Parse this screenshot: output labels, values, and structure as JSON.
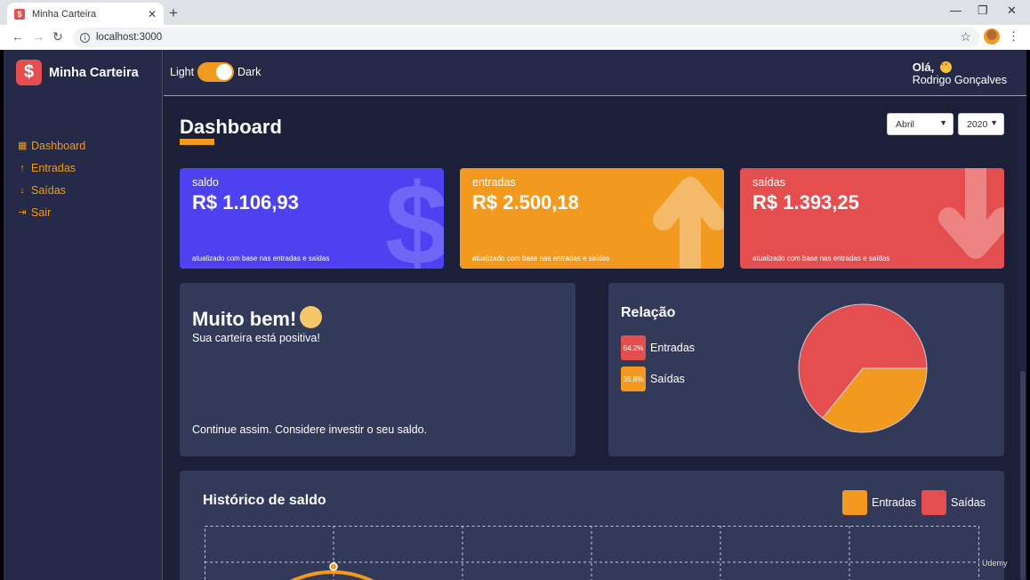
{
  "browser": {
    "tab_title": "Minha Carteira",
    "url": "localhost:3000",
    "new_tab": "+",
    "close_tab": "✕"
  },
  "sidebar": {
    "logo": "$",
    "title": "Minha Carteira",
    "items": [
      {
        "label": "Dashboard",
        "icon": "dashboard-icon",
        "glyph": "▦"
      },
      {
        "label": "Entradas",
        "icon": "arrow-up-icon",
        "glyph": "↑"
      },
      {
        "label": "Saídas",
        "icon": "arrow-down-icon",
        "glyph": "↓"
      },
      {
        "label": "Sair",
        "icon": "exit-icon",
        "glyph": "⇥"
      }
    ]
  },
  "header": {
    "theme_light": "Light",
    "theme_dark": "Dark",
    "greeting": "Olá,",
    "user_name": "Rodrigo Gonçalves"
  },
  "page": {
    "title": "Dashboard",
    "month_select": "Abril",
    "year_select": "2020"
  },
  "cards": [
    {
      "label": "saldo",
      "amount": "R$ 1.106,93",
      "footer": "atualizado com base nas entradas e saídas",
      "color": "#4e41f0",
      "icon": "dollar-icon"
    },
    {
      "label": "entradas",
      "amount": "R$ 2.500,18",
      "footer": "atualizado com base nas entradas e saídas",
      "color": "#f29a1f",
      "icon": "arrow-up-icon"
    },
    {
      "label": "saídas",
      "amount": "R$ 1.393,25",
      "footer": "atualizado com base nas entradas e saídas",
      "color": "#e44e4e",
      "icon": "arrow-down-icon"
    }
  ],
  "message": {
    "title": "Muito bem!",
    "subtitle": "Sua carteira está positiva!",
    "footer": "Continue assim. Considere investir o seu saldo."
  },
  "relation": {
    "title": "Relação",
    "legend": [
      {
        "percent": "64.2%",
        "label": "Entradas",
        "color": "#e44e4e"
      },
      {
        "percent": "35.8%",
        "label": "Saídas",
        "color": "#f29a1f"
      }
    ]
  },
  "chart_data": {
    "type": "pie",
    "slices": [
      {
        "label": "Entradas",
        "value": 64.2,
        "color": "#e44e4e"
      },
      {
        "label": "Saídas",
        "value": 35.8,
        "color": "#f29a1f"
      }
    ]
  },
  "history": {
    "title": "Histórico de saldo",
    "legend": [
      {
        "label": "Entradas",
        "color": "#f29a1f"
      },
      {
        "label": "Saídas",
        "color": "#e44e4e"
      }
    ]
  },
  "watermark": "Udemy",
  "colors": {
    "accent": "#f29a1f",
    "danger": "#e44e4e",
    "primary": "#4e41f0",
    "panel": "#333959"
  }
}
